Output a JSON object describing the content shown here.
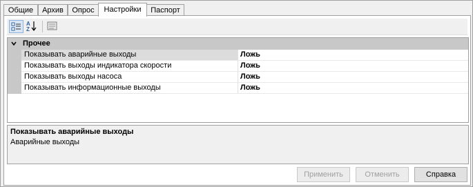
{
  "tabs": [
    {
      "label": "Общие"
    },
    {
      "label": "Архив"
    },
    {
      "label": "Опрос"
    },
    {
      "label": "Настройки"
    },
    {
      "label": "Паспорт"
    }
  ],
  "active_tab": "Настройки",
  "toolbar": {
    "categorized_icon": "categorized-icon",
    "alphabetical_icon": "sort-az-icon",
    "property_pages_icon": "property-pages-icon"
  },
  "grid": {
    "category": {
      "label": "Прочее",
      "expanded": true
    },
    "properties": [
      {
        "name": "Показывать аварийные выходы",
        "value": "Ложь"
      },
      {
        "name": "Показывать выходы индикатора скорости",
        "value": "Ложь"
      },
      {
        "name": "Показывать выходы насоса",
        "value": "Ложь"
      },
      {
        "name": "Показывать информационные выходы",
        "value": "Ложь"
      }
    ]
  },
  "description": {
    "title": "Показывать аварийные выходы",
    "text": "Аварийные выходы"
  },
  "buttons": {
    "apply": "Применить",
    "cancel": "Отменить",
    "help": "Справка"
  }
}
